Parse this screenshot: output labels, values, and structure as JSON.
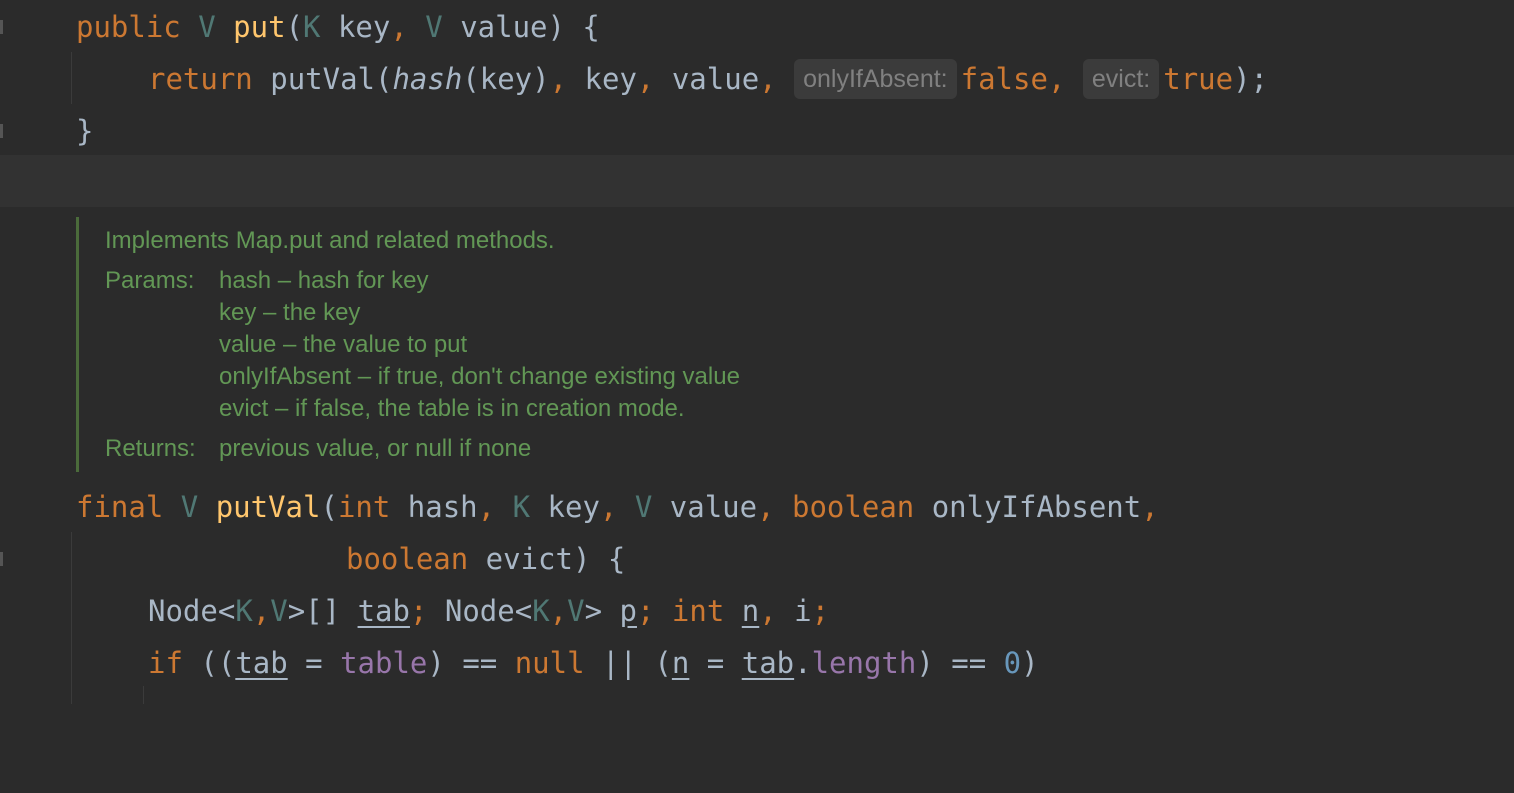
{
  "code_top": {
    "line1": {
      "kw_public": "public",
      "type_v": "V",
      "fn_put": "put",
      "open": "(",
      "type_k": "K",
      "p_key": " key",
      "comma1": ",",
      "type_v2": "V",
      "p_value": " value",
      "close": ") {"
    },
    "line2": {
      "kw_return": "return",
      "call": "putVal(",
      "hash_fn": "hash",
      "args1": "(key)",
      "comma1": ",",
      "key": " key",
      "comma2": ",",
      "value": " value",
      "comma3": ",",
      "hint1": "onlyIfAbsent:",
      "val_false": "false",
      "comma4": ",",
      "hint2": "evict:",
      "val_true": "true",
      "end": ");"
    },
    "line3": {
      "brace": "}"
    }
  },
  "doc": {
    "summary": "Implements Map.put and related methods.",
    "params_label": "Params:",
    "params": [
      "hash – hash for key",
      "key – the key",
      "value – the value to put",
      "onlyIfAbsent – if true, don't change existing value",
      "evict – if false, the table is in creation mode."
    ],
    "returns_label": "Returns:",
    "returns": "previous value, or null if none"
  },
  "code_bottom": {
    "line1": {
      "kw_final": "final",
      "type_v": "V",
      "fn_putval": "putVal",
      "open": "(",
      "kw_int": "int",
      "p_hash": " hash",
      "comma1": ",",
      "type_k": "K",
      "p_key": " key",
      "comma2": ",",
      "type_v2": "V",
      "p_value": " value",
      "comma3": ",",
      "kw_boolean": "boolean",
      "p_only": " onlyIfAbsent",
      "comma4": ","
    },
    "line2": {
      "kw_boolean": "boolean",
      "p_evict": " evict",
      "close": ") {"
    },
    "line3": {
      "node1": "Node<",
      "tk": "K",
      "c1": ",",
      "tv": "V",
      "node1_end": ">[] ",
      "tab": "tab",
      "semi1": ";",
      "node2": " Node<",
      "tk2": "K",
      "c2": ",",
      "tv2": "V",
      "node2_end": "> ",
      "p": "p",
      "semi2": ";",
      "kw_int": "int",
      "n": "n",
      "c3": ",",
      "i": " i",
      "semi3": ";"
    },
    "line4": {
      "kw_if": "if",
      "open": " ((",
      "tab": "tab",
      "eq": " = ",
      "table": "table",
      "close1": ") == ",
      "kw_null": "null",
      "or": " || (",
      "n": "n",
      "eq2": " = ",
      "tab2": "tab",
      "dot": ".",
      "length": "length",
      "close2": ") == ",
      "zero": "0",
      "close3": ")"
    }
  },
  "colors": {
    "background": "#2b2b2b",
    "keyword": "#cc7832",
    "type_param": "#507874",
    "method": "#ffc66d",
    "field": "#9876aa",
    "number": "#6897bb",
    "plain": "#a9b7c6",
    "doc": "#629755",
    "hint_bg": "#3b3b3b"
  }
}
